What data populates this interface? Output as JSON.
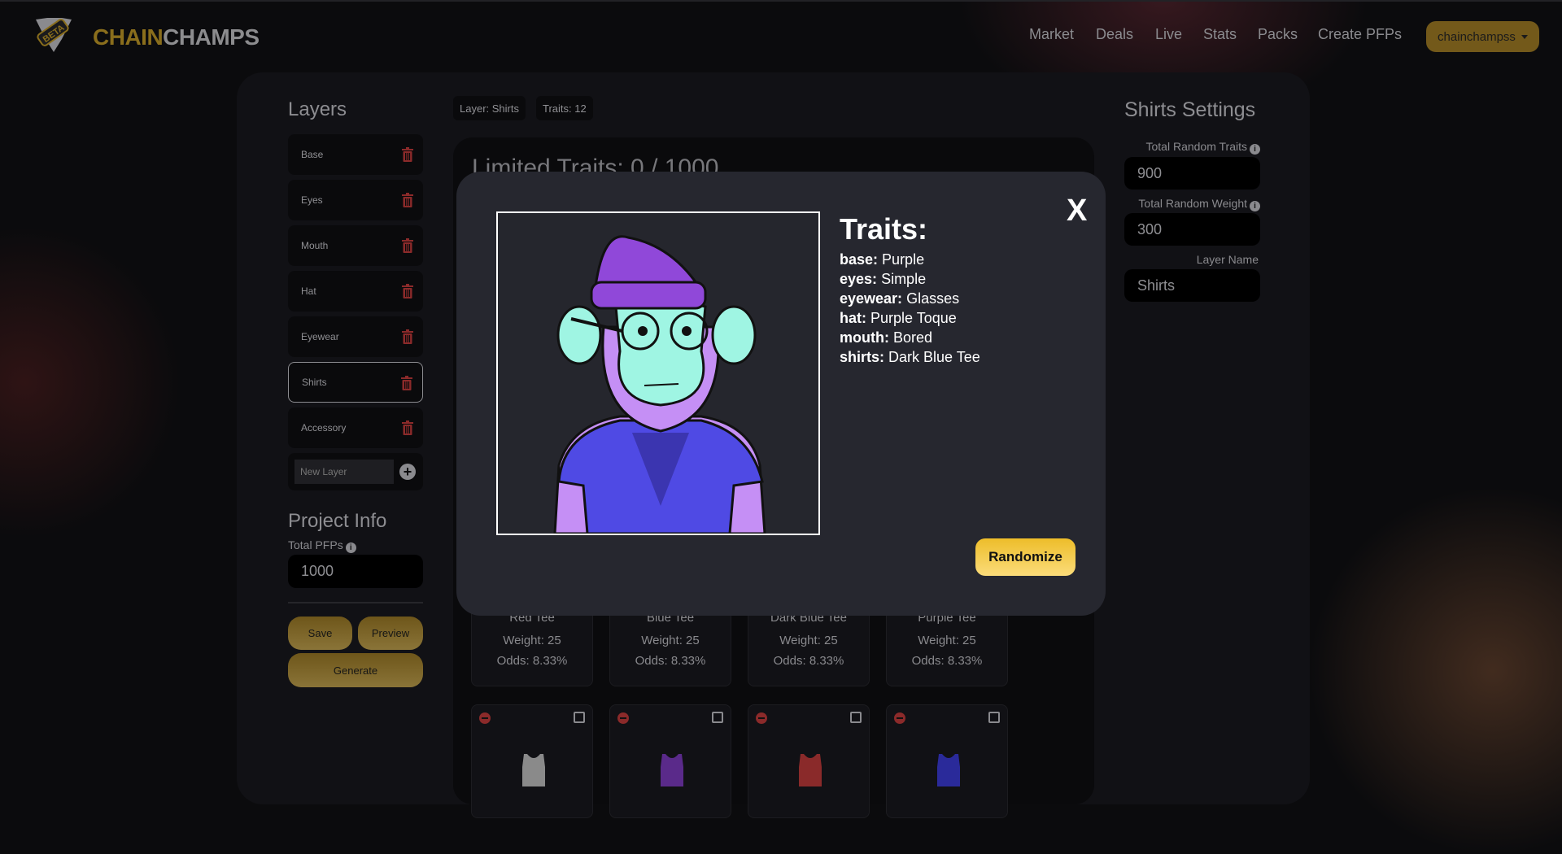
{
  "header": {
    "logo_badge": "BETA",
    "logo_text_a": "CHAIN",
    "logo_text_b": "CHAMPS",
    "nav": [
      "Market",
      "Deals",
      "Live",
      "Stats",
      "Packs",
      "Create PFPs"
    ],
    "user": "chainchampss"
  },
  "sidebar": {
    "title": "Layers",
    "layers": [
      "Base",
      "Eyes",
      "Mouth",
      "Hat",
      "Eyewear",
      "Shirts",
      "Accessory"
    ],
    "selected": "Shirts",
    "new_layer_placeholder": "New Layer"
  },
  "project": {
    "title": "Project Info",
    "total_pfps_label": "Total PFPs",
    "total_pfps": "1000",
    "save": "Save",
    "preview": "Preview",
    "generate": "Generate"
  },
  "badges": {
    "layer": "Layer: Shirts",
    "traits": "Traits: 12"
  },
  "center": {
    "limited": "Limited Traits: 0 / 1000",
    "cards": [
      {
        "name": "Red Tee",
        "weight": "Weight: 25",
        "odds": "Odds: 8.33%"
      },
      {
        "name": "Blue Tee",
        "weight": "Weight: 25",
        "odds": "Odds: 8.33%"
      },
      {
        "name": "Dark Blue Tee",
        "weight": "Weight: 25",
        "odds": "Odds: 8.33%"
      },
      {
        "name": "Purple Tee",
        "weight": "Weight: 25",
        "odds": "Odds: 8.33%"
      }
    ],
    "row2_colors": [
      "#8a8a8a",
      "#5a2a8a",
      "#8a2a2a",
      "#2a2a9a"
    ]
  },
  "settings": {
    "title": "Shirts Settings",
    "random_traits_label": "Total Random Traits",
    "random_traits": "900",
    "random_weight_label": "Total Random Weight",
    "random_weight": "300",
    "layer_name_label": "Layer Name",
    "layer_name": "Shirts"
  },
  "modal": {
    "title": "Traits:",
    "close": "X",
    "randomize": "Randomize",
    "traits": [
      {
        "k": "base:",
        "v": "Purple"
      },
      {
        "k": "eyes:",
        "v": "Simple"
      },
      {
        "k": "eyewear:",
        "v": "Glasses"
      },
      {
        "k": "hat:",
        "v": "Purple Toque"
      },
      {
        "k": "mouth:",
        "v": "Bored"
      },
      {
        "k": "shirts:",
        "v": "Dark Blue Tee"
      }
    ]
  },
  "colors": {
    "accent": "#73591a",
    "randomize": "#f5c842",
    "delete": "#8b2a2a"
  }
}
